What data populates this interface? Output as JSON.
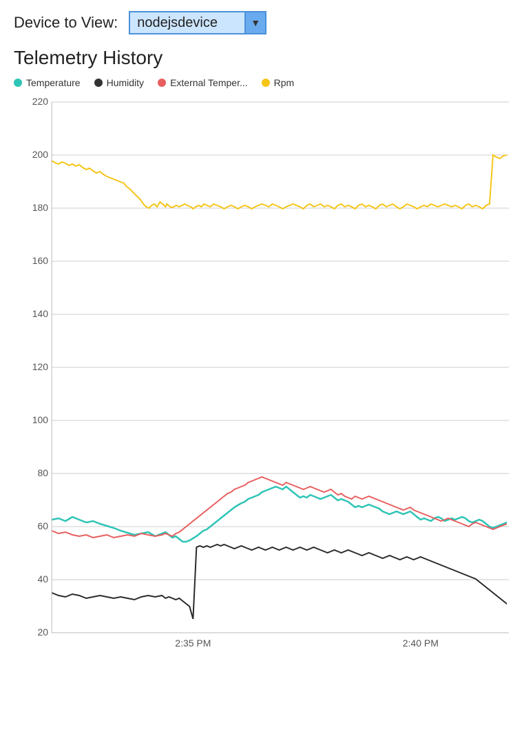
{
  "header": {
    "device_label": "Device to View:",
    "device_value": "nodejsdevice",
    "device_options": [
      "nodejsdevice"
    ]
  },
  "chart": {
    "title": "Telemetry History",
    "legend": [
      {
        "id": "temperature",
        "label": "Temperature",
        "color": "#2ec4b6"
      },
      {
        "id": "humidity",
        "label": "Humidity",
        "color": "#333333"
      },
      {
        "id": "external_temp",
        "label": "External Temper...",
        "color": "#e85d5d"
      },
      {
        "id": "rpm",
        "label": "Rpm",
        "color": "#f5c518"
      }
    ],
    "y_axis_labels": [
      "220",
      "200",
      "180",
      "160",
      "140",
      "120",
      "100",
      "80",
      "60",
      "40",
      "20"
    ],
    "x_axis_labels": [
      "2:35 PM",
      "2:40 PM"
    ],
    "colors": {
      "temperature": "#2ec4b6",
      "humidity": "#333333",
      "external_temp": "#e85d5d",
      "rpm": "#f5c518"
    }
  }
}
